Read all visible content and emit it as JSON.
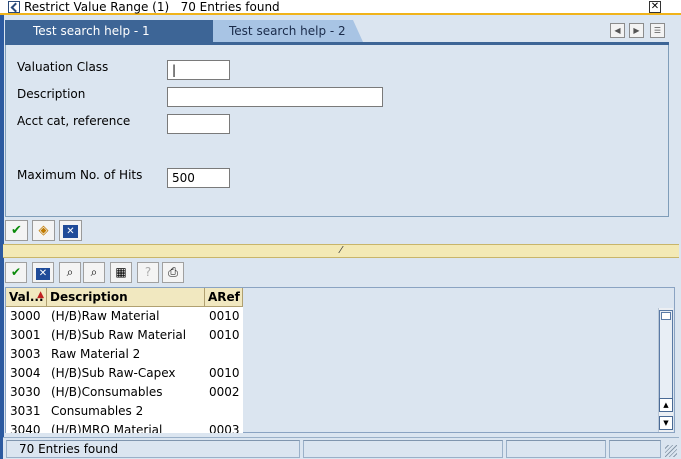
{
  "window": {
    "title": "Restrict Value Range (1)   70 Entries found",
    "close_glyph": "✕"
  },
  "tabs": [
    {
      "label": "Test search help - 1"
    },
    {
      "label": "Test search help - 2"
    }
  ],
  "form": {
    "valuation_class": {
      "label": "Valuation Class",
      "value": "|"
    },
    "description": {
      "label": "Description",
      "value": ""
    },
    "acct_cat": {
      "label": "Acct cat, reference",
      "value": ""
    },
    "max_hits": {
      "label": "Maximum No. of Hits",
      "value": "500"
    }
  },
  "separator": {
    "glyph": "⁄"
  },
  "grid": {
    "columns": [
      "Val...",
      "Description",
      "ARef"
    ],
    "rows": [
      {
        "val": "3000",
        "desc": "(H/B)Raw Material",
        "aref": "0010"
      },
      {
        "val": "3001",
        "desc": "(H/B)Sub Raw Material",
        "aref": "0010"
      },
      {
        "val": "3003",
        "desc": "Raw Material 2",
        "aref": ""
      },
      {
        "val": "3004",
        "desc": "(H/B)Sub Raw-Capex",
        "aref": "0010"
      },
      {
        "val": "3030",
        "desc": "(H/B)Consumables",
        "aref": "0002"
      },
      {
        "val": "3031",
        "desc": "Consumables 2",
        "aref": ""
      },
      {
        "val": "3040",
        "desc": "(H/B)MRO Material",
        "aref": "0003"
      }
    ]
  },
  "status": {
    "message": "70 Entries found"
  },
  "icons": {
    "check": "✔",
    "cancel": "✕",
    "find": "⌕",
    "find_next": "⌕",
    "print": "⎙",
    "up": "▲",
    "down": "▼",
    "left": "◀",
    "right": "▶",
    "menu": "☰"
  }
}
